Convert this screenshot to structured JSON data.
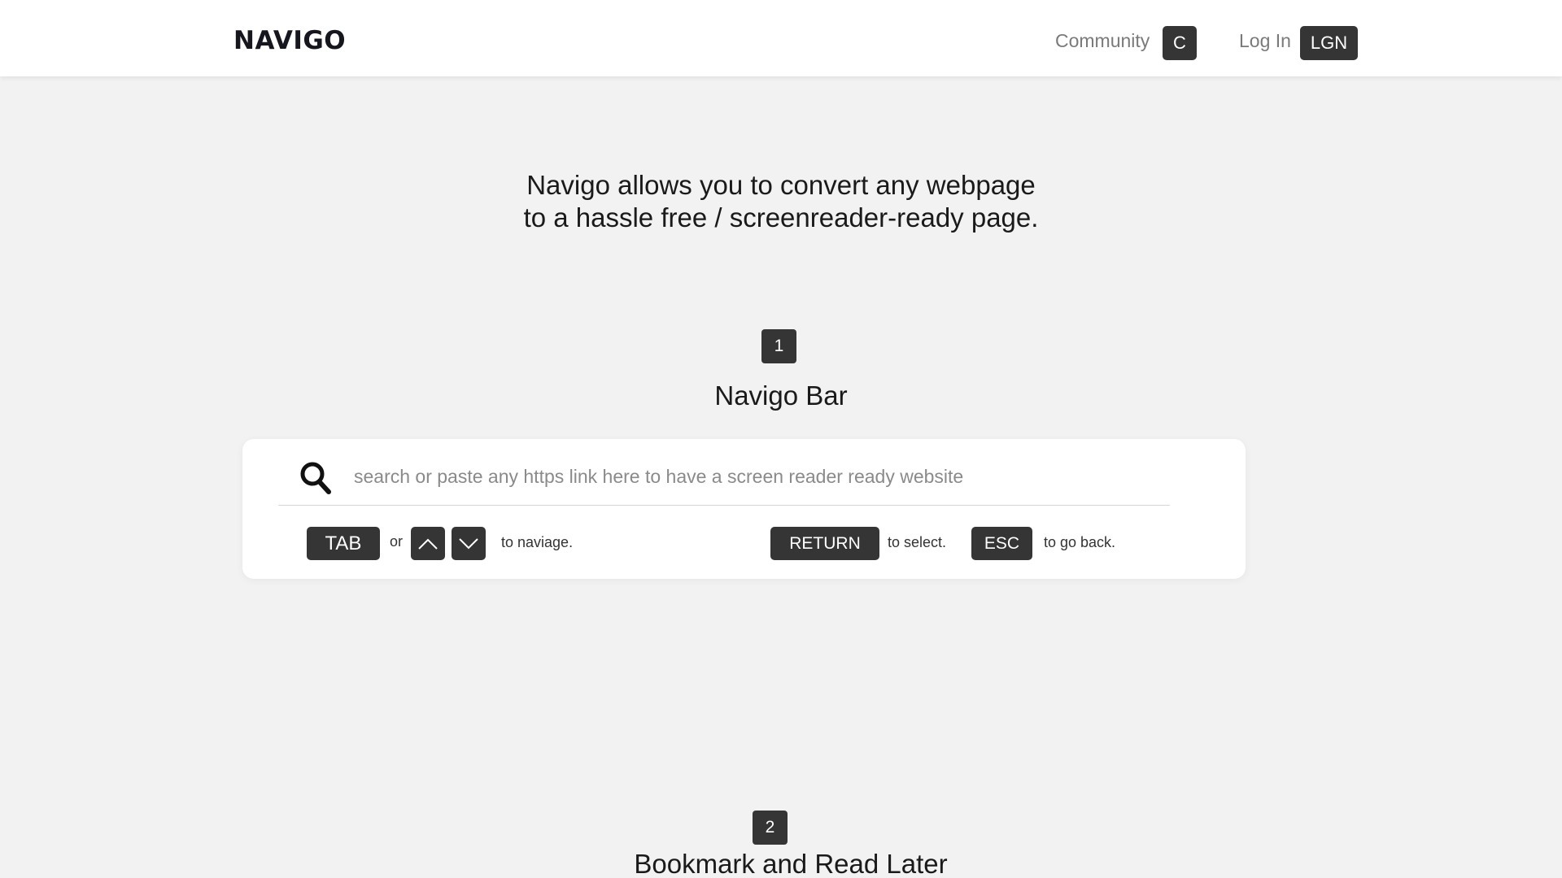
{
  "header": {
    "logo": "NAVIGO",
    "community_label": "Community",
    "community_key": "C",
    "login_label": "Log In",
    "login_key": "LGN"
  },
  "intro": {
    "line1": "Navigo allows you to convert any webpage",
    "line2": "to a hassle free / screenreader-ready page."
  },
  "sections": [
    {
      "number": "1",
      "title": "Navigo Bar"
    },
    {
      "number": "2",
      "title": "Bookmark and Read Later"
    }
  ],
  "navigo_bar": {
    "search_placeholder": "search or paste any https link here to have a screen reader ready website",
    "search_icon": "search-icon",
    "hints": {
      "tab_key": "TAB",
      "or_text": "or",
      "up_icon": "chevron-up-icon",
      "down_icon": "chevron-down-icon",
      "navigate_text": "to naviage.",
      "return_key": "RETURN",
      "select_text": "to select.",
      "esc_key": "ESC",
      "back_text": "to go back."
    }
  },
  "colors": {
    "background": "#f2f2f2",
    "key_background": "#353535",
    "card_background": "#ffffff"
  }
}
